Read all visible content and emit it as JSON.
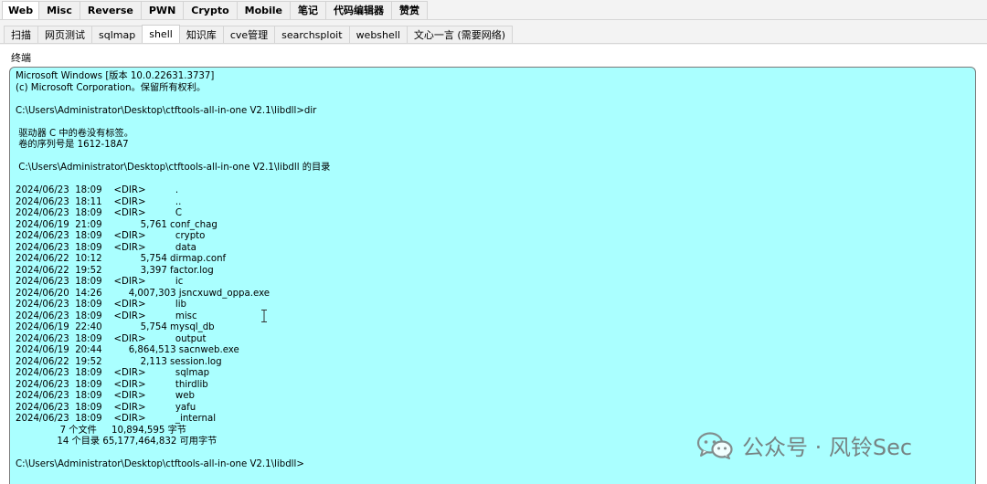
{
  "top_tabs": [
    {
      "label": "Web",
      "active": true
    },
    {
      "label": "Misc",
      "active": false
    },
    {
      "label": "Reverse",
      "active": false
    },
    {
      "label": "PWN",
      "active": false
    },
    {
      "label": "Crypto",
      "active": false
    },
    {
      "label": "Mobile",
      "active": false
    },
    {
      "label": "笔记",
      "active": false
    },
    {
      "label": "代码编辑器",
      "active": false
    },
    {
      "label": "赞赏",
      "active": false
    }
  ],
  "sub_tabs": [
    {
      "label": "扫描",
      "active": false
    },
    {
      "label": "网页测试",
      "active": false
    },
    {
      "label": "sqlmap",
      "active": false
    },
    {
      "label": "shell",
      "active": true
    },
    {
      "label": "知识库",
      "active": false
    },
    {
      "label": "cve管理",
      "active": false
    },
    {
      "label": "searchsploit",
      "active": false
    },
    {
      "label": "webshell",
      "active": false
    },
    {
      "label": "文心一言 (需要网络)",
      "active": false
    }
  ],
  "terminal": {
    "label": "终端",
    "background": "#aaffff",
    "lines": [
      "Microsoft Windows [版本 10.0.22631.3737]",
      "(c) Microsoft Corporation。保留所有权利。",
      "",
      "C:\\Users\\Administrator\\Desktop\\ctftools-all-in-one V2.1\\libdll>dir",
      "",
      " 驱动器 C 中的卷没有标签。",
      " 卷的序列号是 1612-18A7",
      "",
      " C:\\Users\\Administrator\\Desktop\\ctftools-all-in-one V2.1\\libdll 的目录",
      "",
      "2024/06/23  18:09    <DIR>          .",
      "2024/06/23  18:11    <DIR>          ..",
      "2024/06/23  18:09    <DIR>          C",
      "2024/06/19  21:09             5,761 conf_chag",
      "2024/06/23  18:09    <DIR>          crypto",
      "2024/06/23  18:09    <DIR>          data",
      "2024/06/22  10:12             5,754 dirmap.conf",
      "2024/06/22  19:52             3,397 factor.log",
      "2024/06/23  18:09    <DIR>          ic",
      "2024/06/20  14:26         4,007,303 jsncxuwd_oppa.exe",
      "2024/06/23  18:09    <DIR>          lib",
      "2024/06/23  18:09    <DIR>          misc",
      "2024/06/19  22:40             5,754 mysql_db",
      "2024/06/23  18:09    <DIR>          output",
      "2024/06/19  20:44         6,864,513 sacnweb.exe",
      "2024/06/22  19:52             2,113 session.log",
      "2024/06/23  18:09    <DIR>          sqlmap",
      "2024/06/23  18:09    <DIR>          thirdlib",
      "2024/06/23  18:09    <DIR>          web",
      "2024/06/23  18:09    <DIR>          yafu",
      "2024/06/23  18:09    <DIR>          _internal",
      "               7 个文件     10,894,595 字节",
      "              14 个目录 65,177,464,832 可用字节",
      "",
      "C:\\Users\\Administrator\\Desktop\\ctftools-all-in-one V2.1\\libdll>"
    ]
  },
  "watermark": {
    "text": "公众号 · 风铃Sec",
    "icon": "wechat-icon"
  }
}
